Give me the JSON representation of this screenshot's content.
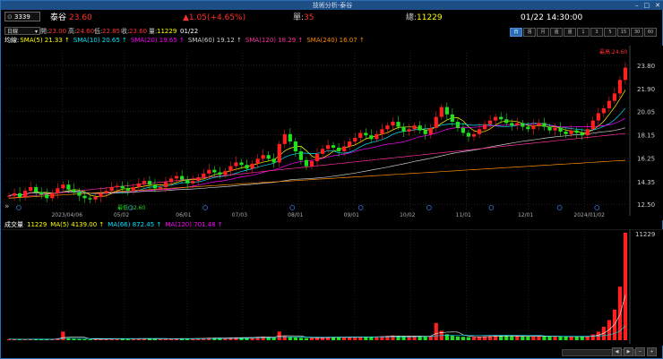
{
  "window": {
    "title": "技術分析-泰谷",
    "controls": [
      "–",
      "□",
      "✕"
    ]
  },
  "quote": {
    "code": "3339",
    "name": "泰谷",
    "price": "23.60",
    "change": "▲1.05(+4.65%)",
    "unit_label": "單:",
    "unit_value": "35",
    "total_label": "總:",
    "total_value": "11229",
    "datetime": "01/22 14:30:00"
  },
  "info": {
    "period": "日線",
    "open_label": "開:",
    "open": "23.00",
    "high_label": "高:",
    "high": "24.60",
    "low_label": "低:",
    "low": "22.85",
    "close_label": "收:",
    "close": "23.60",
    "volume_label": "量:",
    "volume": "11229",
    "date": "01/22"
  },
  "timeframes": [
    "日",
    "週",
    "月",
    "還",
    "還",
    "1",
    "3",
    "5",
    "15",
    "30",
    "60"
  ],
  "timeframe_active": 0,
  "ma_legend": {
    "title": "均線:",
    "items": [
      {
        "label": "SMA(5) 21.33 ↑",
        "color": "#ffff00"
      },
      {
        "label": "SMA(10) 20.65 ↑",
        "color": "#00e5ff"
      },
      {
        "label": "SMA(20) 19.65 ↑",
        "color": "#ff00ff"
      },
      {
        "label": "SMA(60) 19.12 ↑",
        "color": "#cccccc"
      },
      {
        "label": "SMA(120) 18.29 ↑",
        "color": "#ff2da0"
      },
      {
        "label": "SMA(240) 16.07 ↑",
        "color": "#ff8c00"
      }
    ]
  },
  "vol_legend": {
    "title": "成交量",
    "value": "11229",
    "items": [
      {
        "label": "MA(5) 4139.00 ↑",
        "color": "#ffff00"
      },
      {
        "label": "MA(66) 872.45 ↑",
        "color": "#00e5ff"
      },
      {
        "label": "MA(120) 701.48 ↑",
        "color": "#ff00ff"
      }
    ]
  },
  "chart_data": {
    "type": "candlestick",
    "price_axis": [
      "23.80",
      "21.90",
      "20.05",
      "18.15",
      "16.25",
      "14.35",
      "12.50"
    ],
    "price_range": [
      12.3,
      24.8
    ],
    "date_axis": [
      "2023/04/06",
      "05/02",
      "06/01",
      "07/03",
      "08/01",
      "09/01",
      "10/02",
      "11/01",
      "12/01",
      "2024/01/02"
    ],
    "volume_axis": [
      "11229"
    ],
    "annotations": {
      "high": "最高:24.60",
      "low": "最低:12.60"
    },
    "series_close": [
      13.2,
      13.4,
      13.1,
      13.6,
      13.9,
      13.5,
      13.3,
      13.0,
      13.4,
      13.8,
      14.1,
      13.7,
      13.5,
      13.2,
      13.0,
      12.9,
      13.1,
      13.4,
      13.6,
      13.9,
      14.0,
      13.8,
      13.6,
      13.9,
      14.2,
      14.4,
      14.1,
      13.8,
      13.9,
      14.3,
      14.6,
      14.8,
      14.5,
      14.2,
      14.4,
      14.7,
      15.0,
      15.3,
      15.1,
      14.9,
      15.2,
      15.6,
      15.9,
      15.7,
      15.4,
      15.8,
      16.2,
      16.5,
      16.2,
      15.9,
      17.4,
      18.2,
      17.6,
      16.8,
      16.1,
      15.6,
      16.0,
      16.6,
      17.0,
      17.3,
      17.1,
      16.8,
      17.2,
      17.6,
      17.9,
      18.3,
      18.1,
      17.8,
      18.2,
      18.6,
      18.9,
      19.2,
      18.8,
      18.4,
      18.6,
      18.9,
      18.5,
      18.2,
      18.7,
      19.6,
      20.4,
      19.8,
      19.2,
      18.7,
      18.3,
      18.0,
      18.2,
      18.6,
      19.0,
      19.3,
      19.6,
      19.4,
      19.1,
      18.9,
      19.1,
      18.8,
      18.6,
      18.9,
      19.1,
      18.8,
      18.5,
      18.7,
      18.4,
      18.2,
      18.5,
      18.3,
      18.1,
      18.6,
      19.3,
      19.9,
      20.3,
      20.9,
      21.5,
      22.6,
      23.6
    ],
    "volume_values": [
      120,
      90,
      80,
      100,
      140,
      110,
      95,
      85,
      100,
      200,
      900,
      220,
      160,
      120,
      100,
      90,
      110,
      130,
      150,
      180,
      160,
      140,
      120,
      130,
      150,
      170,
      160,
      140,
      130,
      150,
      180,
      200,
      170,
      150,
      160,
      190,
      220,
      260,
      240,
      210,
      240,
      280,
      300,
      280,
      260,
      300,
      340,
      380,
      320,
      280,
      900,
      420,
      360,
      300,
      260,
      220,
      240,
      280,
      300,
      320,
      300,
      280,
      300,
      320,
      340,
      380,
      360,
      330,
      360,
      400,
      450,
      500,
      440,
      400,
      420,
      460,
      420,
      390,
      440,
      1800,
      980,
      620,
      480,
      400,
      360,
      320,
      340,
      380,
      420,
      450,
      480,
      460,
      430,
      410,
      430,
      400,
      380,
      410,
      440,
      410,
      380,
      400,
      380,
      360,
      380,
      360,
      350,
      420,
      600,
      900,
      1400,
      2100,
      3200,
      5600,
      11229
    ]
  }
}
